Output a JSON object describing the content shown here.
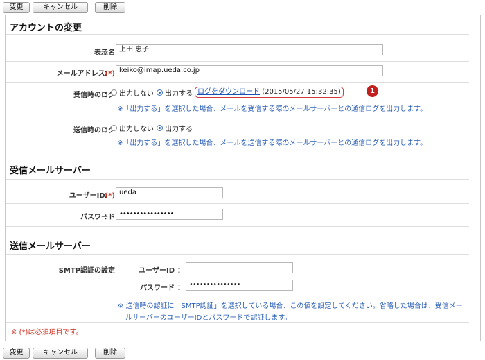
{
  "toolbar": {
    "change_label": "変更",
    "cancel_label": "キャンセル",
    "delete_label": "削除"
  },
  "account": {
    "title": "アカウントの変更",
    "display_name_label": "表示名",
    "display_name_value": "上田 恵子",
    "email_label": "メールアドレス",
    "email_value": "keiko@imap.ueda.co.jp",
    "recv_log_label": "受信時のログ",
    "send_log_label": "送信時のログ",
    "log_no": "出力しない",
    "log_yes": "出力する",
    "download_link": "ログをダウンロード",
    "download_timestamp": "(2015/05/27 15:32:35)",
    "recv_log_note": "※「出力する」を選択した場合、メールを受信する際のメールサーバーとの通信ログを出力します。",
    "send_log_note": "※「出力する」を選択した場合、メールを送信する際のメールサーバーとの通信ログを出力します。"
  },
  "incoming": {
    "title": "受信メールサーバー",
    "user_id_label": "ユーザーID",
    "user_id_value": "ueda",
    "password_label": "パスワード",
    "password_value": "••••••••••••••••"
  },
  "outgoing": {
    "title": "送信メールサーバー",
    "smtp_label": "SMTP認証の設定",
    "user_id_label": "ユーザーID",
    "password_label": "パスワード",
    "password_value": "•••••••••••••••",
    "note_line1": "※ 送信時の認証に「SMTP認証」を選択している場合、この値を設定してください。省略した場合は、受信メー",
    "note_line2": "ルサーバーのユーザーIDとパスワードで認証します。"
  },
  "common": {
    "required_mark": "(*)",
    "colon": "：",
    "required_note": "※ (*)は必須項目です。",
    "callout_number": "1"
  },
  "colors": {
    "accent": "#2b5fb8",
    "required": "#d0301f",
    "callout": "#c21f1f"
  }
}
